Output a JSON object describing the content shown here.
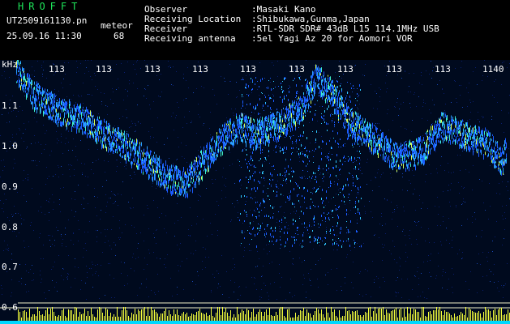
{
  "app": {
    "title": "HROFFT"
  },
  "file": {
    "name": "UT2509161130.pn",
    "datetime": "25.09.16 11:30",
    "mode": "meteor",
    "count": "68"
  },
  "info": {
    "labels": [
      "Observer",
      "Receiving Location",
      "Receiver",
      "Receiving antenna"
    ],
    "values": [
      ":Masaki Kano",
      ":Shibukawa,Gunma,Japan",
      ":RTL-SDR SDR# 43dB L15 114.1MHz USB",
      ":5el Yagi Az 20 for Aomori VOR"
    ]
  },
  "time_axis": {
    "ticks": [
      "113",
      "113",
      "113",
      "113",
      "113",
      "113",
      "113",
      "113",
      "113",
      "1140"
    ]
  },
  "freq_axis": {
    "unit": "kHz",
    "ticks": [
      "1.1",
      "1.0",
      "0.9",
      "0.8",
      "0.7",
      "0.6"
    ]
  },
  "colors": {
    "title": "#1ee65a",
    "text": "#ffffff",
    "background": "#000000",
    "baseline": "#f5ff3c",
    "baseline2": "#00e0ff"
  }
}
